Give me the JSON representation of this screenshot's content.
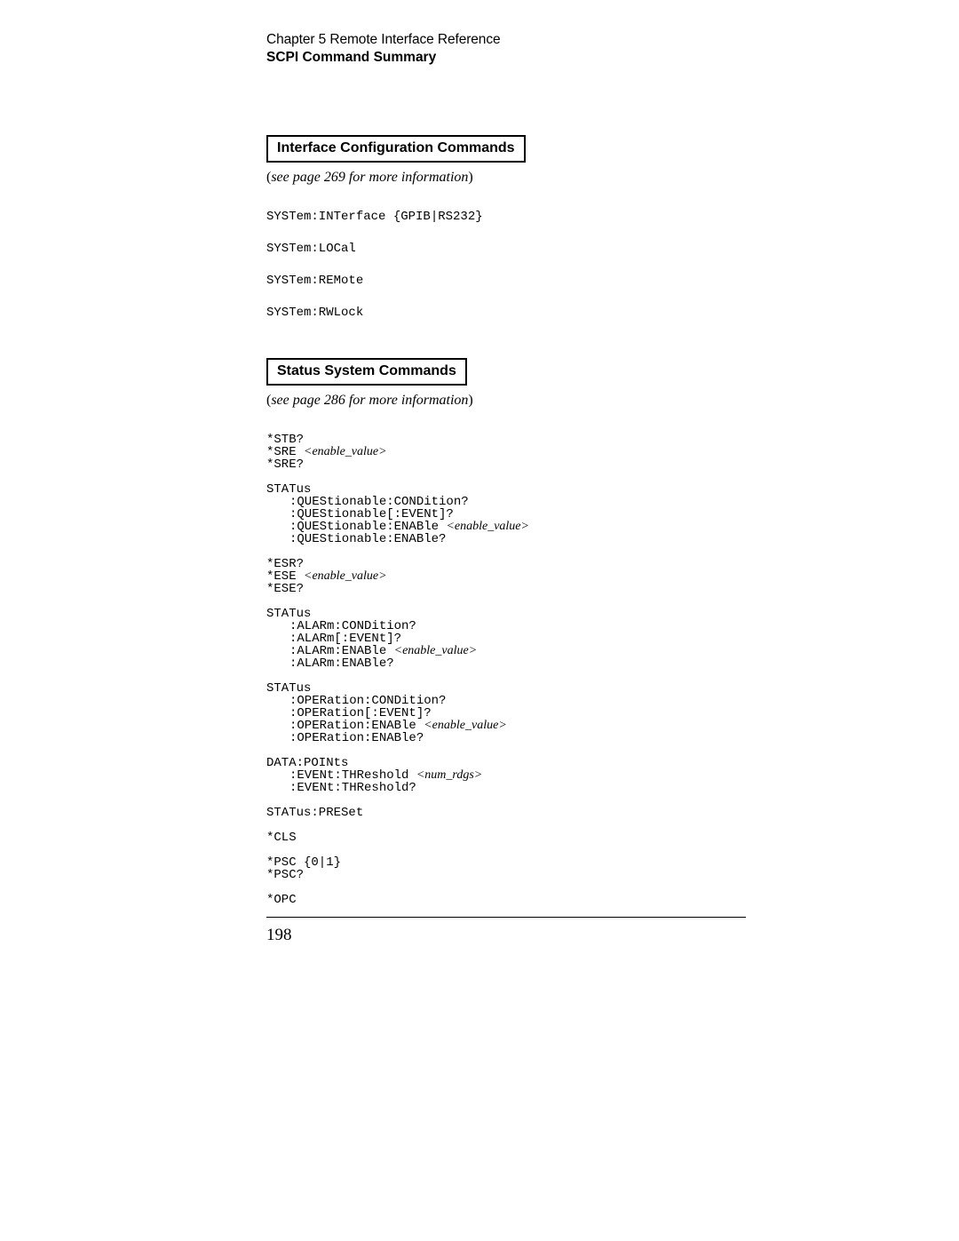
{
  "header": {
    "chapter": "Chapter 5  Remote Interface Reference",
    "subtitle": "SCPI Command Summary"
  },
  "sections": [
    {
      "title": "Interface Configuration Commands",
      "note_prefix": "(",
      "note_italic": "see page 269 for more information",
      "note_suffix": ")",
      "lines": [
        {
          "seg": [
            {
              "t": "m",
              "v": "SYSTem:INTerface {GPIB|RS232}"
            }
          ],
          "cls": ""
        },
        {
          "seg": [
            {
              "t": "m",
              "v": "SYSTem:LOCal"
            }
          ],
          "cls": "bgap"
        },
        {
          "seg": [
            {
              "t": "m",
              "v": "SYSTem:REMote"
            }
          ],
          "cls": "bgap"
        },
        {
          "seg": [
            {
              "t": "m",
              "v": "SYSTem:RWLock"
            }
          ],
          "cls": "bgap"
        }
      ]
    },
    {
      "title": "Status System Commands",
      "note_prefix": "(",
      "note_italic": "see page 286 for more information",
      "note_suffix": ")",
      "lines": [
        {
          "seg": [
            {
              "t": "m",
              "v": "*STB?"
            }
          ],
          "cls": ""
        },
        {
          "seg": [
            {
              "t": "m",
              "v": "*SRE "
            },
            {
              "t": "a",
              "v": "<enable_value>"
            }
          ],
          "cls": ""
        },
        {
          "seg": [
            {
              "t": "m",
              "v": "*SRE?"
            }
          ],
          "cls": ""
        },
        {
          "seg": [
            {
              "t": "m",
              "v": "STATus"
            }
          ],
          "cls": "gap"
        },
        {
          "seg": [
            {
              "t": "m",
              "v": ":QUEStionable:CONDition?"
            }
          ],
          "cls": "indent"
        },
        {
          "seg": [
            {
              "t": "m",
              "v": ":QUEStionable[:EVENt]?"
            }
          ],
          "cls": "indent"
        },
        {
          "seg": [
            {
              "t": "m",
              "v": ":QUEStionable:ENABle "
            },
            {
              "t": "a",
              "v": "<enable_value>"
            }
          ],
          "cls": "indent"
        },
        {
          "seg": [
            {
              "t": "m",
              "v": ":QUEStionable:ENABle?"
            }
          ],
          "cls": "indent"
        },
        {
          "seg": [
            {
              "t": "m",
              "v": "*ESR?"
            }
          ],
          "cls": "gap"
        },
        {
          "seg": [
            {
              "t": "m",
              "v": "*ESE "
            },
            {
              "t": "a",
              "v": "<enable_value>"
            }
          ],
          "cls": ""
        },
        {
          "seg": [
            {
              "t": "m",
              "v": "*ESE?"
            }
          ],
          "cls": ""
        },
        {
          "seg": [
            {
              "t": "m",
              "v": "STATus"
            }
          ],
          "cls": "gap"
        },
        {
          "seg": [
            {
              "t": "m",
              "v": ":ALARm:CONDition?"
            }
          ],
          "cls": "indent"
        },
        {
          "seg": [
            {
              "t": "m",
              "v": ":ALARm[:EVENt]?"
            }
          ],
          "cls": "indent"
        },
        {
          "seg": [
            {
              "t": "m",
              "v": ":ALARm:ENABle "
            },
            {
              "t": "a",
              "v": "<enable_value>"
            }
          ],
          "cls": "indent"
        },
        {
          "seg": [
            {
              "t": "m",
              "v": ":ALARm:ENABle?"
            }
          ],
          "cls": "indent"
        },
        {
          "seg": [
            {
              "t": "m",
              "v": "STATus"
            }
          ],
          "cls": "gap"
        },
        {
          "seg": [
            {
              "t": "m",
              "v": ":OPERation:CONDition?"
            }
          ],
          "cls": "indent"
        },
        {
          "seg": [
            {
              "t": "m",
              "v": ":OPERation[:EVENt]?"
            }
          ],
          "cls": "indent"
        },
        {
          "seg": [
            {
              "t": "m",
              "v": ":OPERation:ENABle "
            },
            {
              "t": "a",
              "v": "<enable_value>"
            }
          ],
          "cls": "indent"
        },
        {
          "seg": [
            {
              "t": "m",
              "v": ":OPERation:ENABle?"
            }
          ],
          "cls": "indent"
        },
        {
          "seg": [
            {
              "t": "m",
              "v": "DATA:POINts"
            }
          ],
          "cls": "gap"
        },
        {
          "seg": [
            {
              "t": "m",
              "v": ":EVENt:THReshold "
            },
            {
              "t": "a",
              "v": "<num_rdgs>"
            }
          ],
          "cls": "indent"
        },
        {
          "seg": [
            {
              "t": "m",
              "v": ":EVENt:THReshold?"
            }
          ],
          "cls": "indent"
        },
        {
          "seg": [
            {
              "t": "m",
              "v": "STATus:PRESet"
            }
          ],
          "cls": "gap"
        },
        {
          "seg": [
            {
              "t": "m",
              "v": "*CLS"
            }
          ],
          "cls": "gap"
        },
        {
          "seg": [
            {
              "t": "m",
              "v": "*PSC {0|1}"
            }
          ],
          "cls": "gap"
        },
        {
          "seg": [
            {
              "t": "m",
              "v": "*PSC?"
            }
          ],
          "cls": ""
        },
        {
          "seg": [
            {
              "t": "m",
              "v": "*OPC"
            }
          ],
          "cls": "gap"
        }
      ]
    }
  ],
  "page_number": "198"
}
